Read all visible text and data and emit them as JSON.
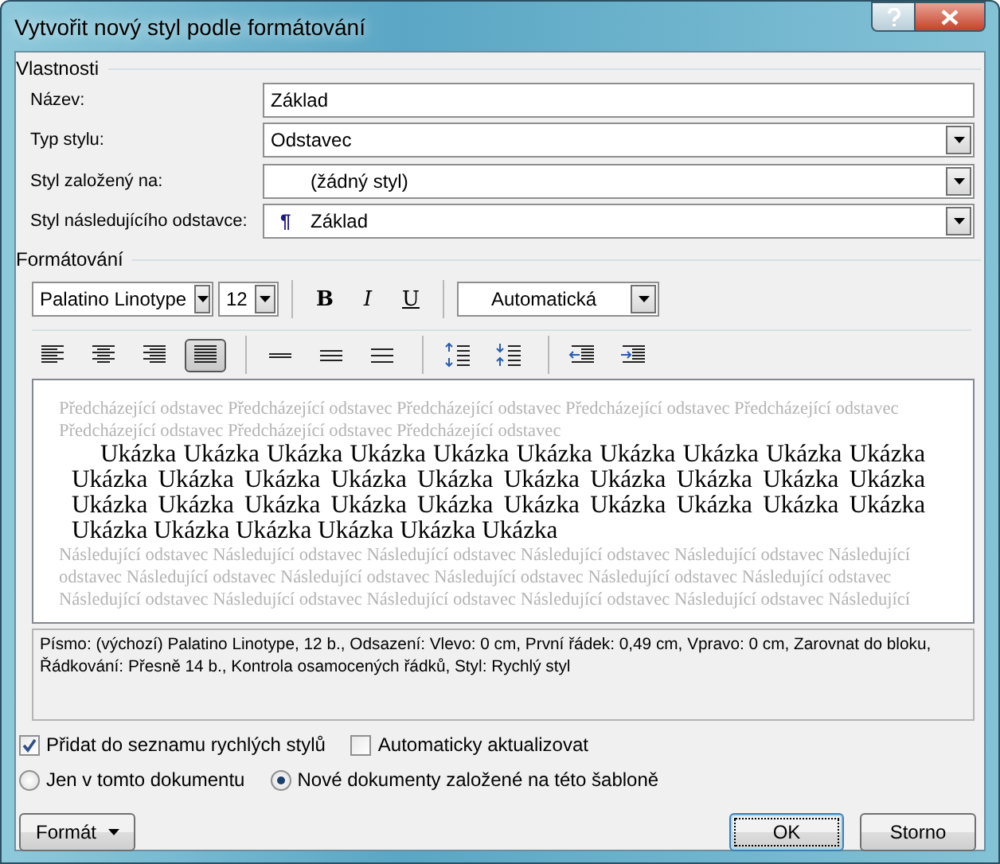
{
  "window": {
    "title": "Vytvořit nový styl podle formátování"
  },
  "properties": {
    "legend": "Vlastnosti",
    "fields": [
      {
        "label": "Název:",
        "kind": "text",
        "value": "Základ"
      },
      {
        "label": "Typ stylu:",
        "kind": "combo",
        "value": "Odstavec"
      },
      {
        "label": "Styl založený na:",
        "kind": "style-combo",
        "value": "(žádný styl)"
      },
      {
        "label": "Styl následujícího odstavce:",
        "kind": "style-combo",
        "symbol": "¶",
        "value": "Základ"
      }
    ]
  },
  "formatting": {
    "legend": "Formátování",
    "font": "Palatino Linotype",
    "size": "12",
    "color_choice": "Automatická",
    "format_buttons": [
      {
        "label": "B",
        "kind": "bold",
        "selected": false
      },
      {
        "label": "I",
        "kind": "italic",
        "selected": false
      },
      {
        "label": "U",
        "kind": "underline",
        "selected": false
      }
    ],
    "paragraph_buttons": [
      {
        "kind": "align-left",
        "selected": false
      },
      {
        "kind": "align-center",
        "selected": false
      },
      {
        "kind": "align-right",
        "selected": false
      },
      {
        "kind": "justify",
        "selected": true
      },
      {
        "kind": "single-spacing",
        "selected": false
      },
      {
        "kind": "one-half-spacing",
        "selected": false
      },
      {
        "kind": "double-spacing",
        "selected": false
      },
      {
        "kind": "space-before",
        "selected": false
      },
      {
        "kind": "space-after",
        "selected": false
      },
      {
        "kind": "decrease-indent",
        "selected": false
      },
      {
        "kind": "increase-indent",
        "selected": false
      }
    ]
  },
  "preview": {
    "preceding": [
      "Předcházející odstavec Předcházející odstavec Předcházející odstavec Předcházející odstavec Předcházející odstavec",
      "Předcházející odstavec Předcházející odstavec Předcházející odstavec"
    ],
    "sample": [
      "Ukázka Ukázka Ukázka Ukázka Ukázka Ukázka Ukázka Ukázka Ukázka Ukázka",
      "Ukázka Ukázka Ukázka Ukázka Ukázka Ukázka Ukázka Ukázka Ukázka Ukázka",
      "Ukázka Ukázka Ukázka Ukázka Ukázka Ukázka Ukázka Ukázka Ukázka Ukázka",
      "Ukázka Ukázka Ukázka Ukázka Ukázka Ukázka"
    ],
    "following": [
      "Následující odstavec Následující odstavec Následující odstavec Následující odstavec Následující odstavec Následující",
      "odstavec Následující odstavec Následující odstavec Následující odstavec Následující odstavec Následující odstavec",
      "Následující odstavec Následující odstavec Následující odstavec Následující odstavec Následující odstavec Následující"
    ]
  },
  "description": [
    "Písmo: (výchozí) Palatino Linotype, 12 b., Odsazení: Vlevo:  0 cm, První řádek:  0,49 cm, Vpravo:  0 cm, Zarovnat do bloku,",
    "Řádkování:  Přesně 14 b., Kontrola osamocených řádků, Styl: Rychlý styl"
  ],
  "checkboxes": [
    {
      "label": "Přidat do seznamu rychlých stylů",
      "checked": true
    },
    {
      "label": "Automaticky aktualizovat",
      "checked": false
    }
  ],
  "radios": [
    {
      "label": "Jen v tomto dokumentu",
      "selected": false
    },
    {
      "label": "Nové dokumenty založené na této šabloně",
      "selected": true
    }
  ],
  "buttons": [
    {
      "label": "Formát",
      "kind": "menu"
    },
    {
      "label": "OK",
      "kind": "default"
    },
    {
      "label": "Storno",
      "kind": "normal"
    }
  ]
}
